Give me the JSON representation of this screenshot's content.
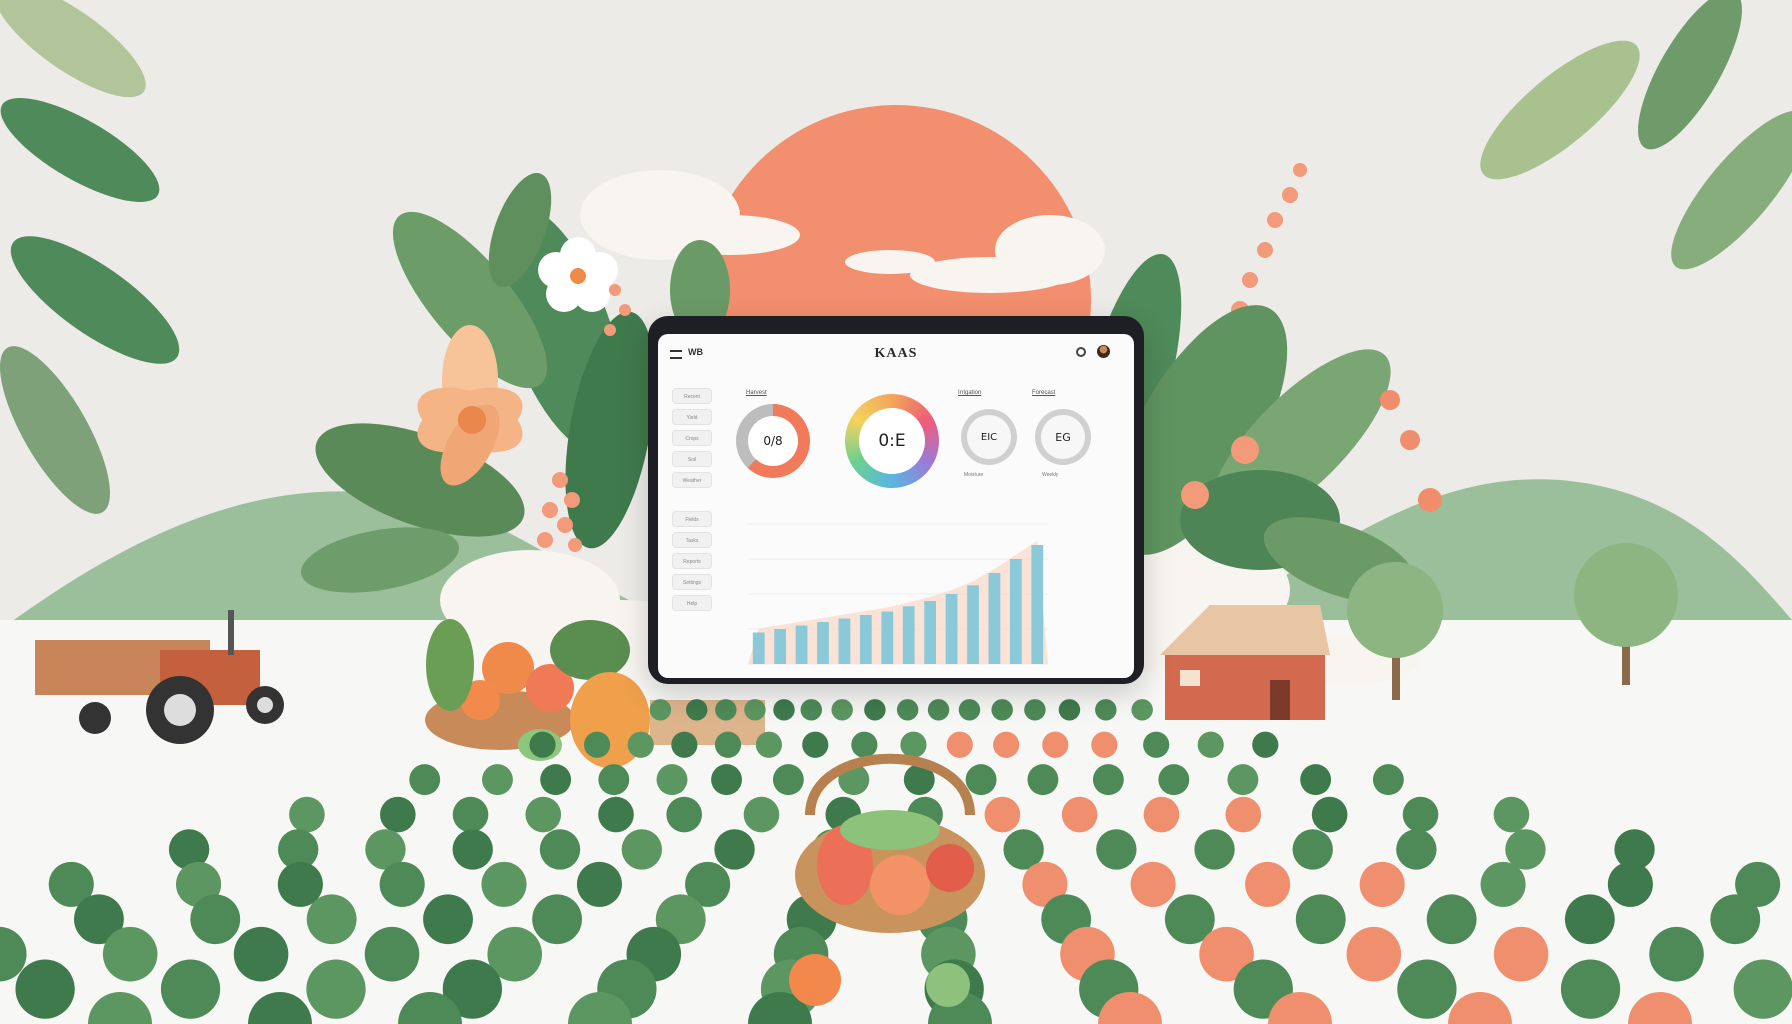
{
  "app": {
    "title": "KAAS",
    "brand_small": "WB",
    "icons": {
      "menu": "menu-icon",
      "settings": "gear-icon",
      "profile": "avatar"
    }
  },
  "sidebar": {
    "items": [
      {
        "label": "Recent"
      },
      {
        "label": "Yield"
      },
      {
        "label": "Crops"
      },
      {
        "label": "Soil"
      },
      {
        "label": "Weather"
      },
      {
        "label": "Fields"
      },
      {
        "label": "Tasks"
      },
      {
        "label": "Reports"
      },
      {
        "label": "Settings"
      },
      {
        "label": "Help"
      }
    ]
  },
  "stats": [
    {
      "label": "Harvest",
      "value": "0/8",
      "progress": 0.62,
      "accent": "#f07a5a"
    },
    {
      "label": "",
      "value": "0:E",
      "progress": 1.0
    },
    {
      "label": "Irrigation",
      "value": "EIC",
      "caption": "Moisture"
    },
    {
      "label": "Forecast",
      "value": "EG",
      "caption": "Weekly"
    }
  ],
  "colors": {
    "accent": "#f07a5a",
    "bar": "#8cc9d8",
    "sun": "#f28f6e",
    "leaf": "#5e8f5a",
    "background": "#ecebe8"
  },
  "chart_data": {
    "type": "bar",
    "title": "",
    "xlabel": "",
    "ylabel": "",
    "values": [
      18,
      20,
      22,
      24,
      26,
      28,
      30,
      33,
      36,
      40,
      45,
      52,
      60,
      68
    ],
    "ylim": [
      0,
      80
    ],
    "area_trend": true,
    "grid": true
  }
}
